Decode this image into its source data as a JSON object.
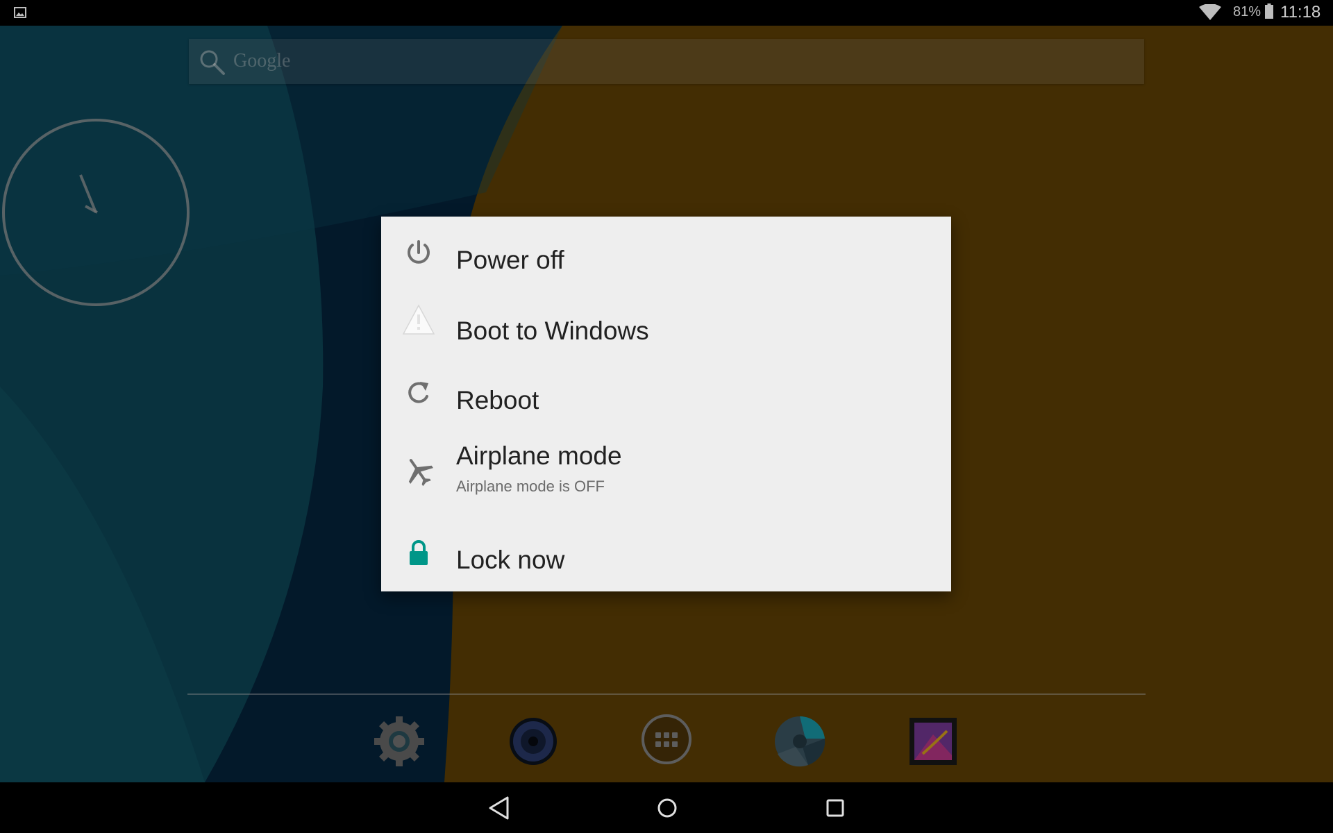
{
  "status_bar": {
    "battery_percent": "81%",
    "time": "11:18",
    "icons": [
      "gallery-notification-icon",
      "wifi-icon",
      "battery-icon"
    ]
  },
  "search": {
    "placeholder": "Google",
    "icon": "search-icon"
  },
  "power_menu": {
    "items": [
      {
        "label": "Power off",
        "icon": "power-icon"
      },
      {
        "label": "Boot to Windows",
        "icon": "warning-icon"
      },
      {
        "label": "Reboot",
        "icon": "reboot-icon"
      },
      {
        "label": "Airplane mode",
        "sub": "Airplane mode is OFF",
        "icon": "airplane-icon"
      },
      {
        "label": "Lock now",
        "icon": "lock-icon",
        "icon_color": "#009688"
      }
    ]
  },
  "dock": {
    "apps": [
      "settings-app-icon",
      "music-app-icon",
      "all-apps-icon",
      "camera-app-icon",
      "gallery-app-icon"
    ]
  },
  "nav_bar": {
    "buttons": [
      "back-button",
      "home-button",
      "recents-button"
    ]
  },
  "colors": {
    "wallpaper_teal": "#0e4a5c",
    "wallpaper_navy": "#05253f",
    "wallpaper_amber": "#634305",
    "dialog_bg": "#eeeeee",
    "accent": "#009688"
  }
}
